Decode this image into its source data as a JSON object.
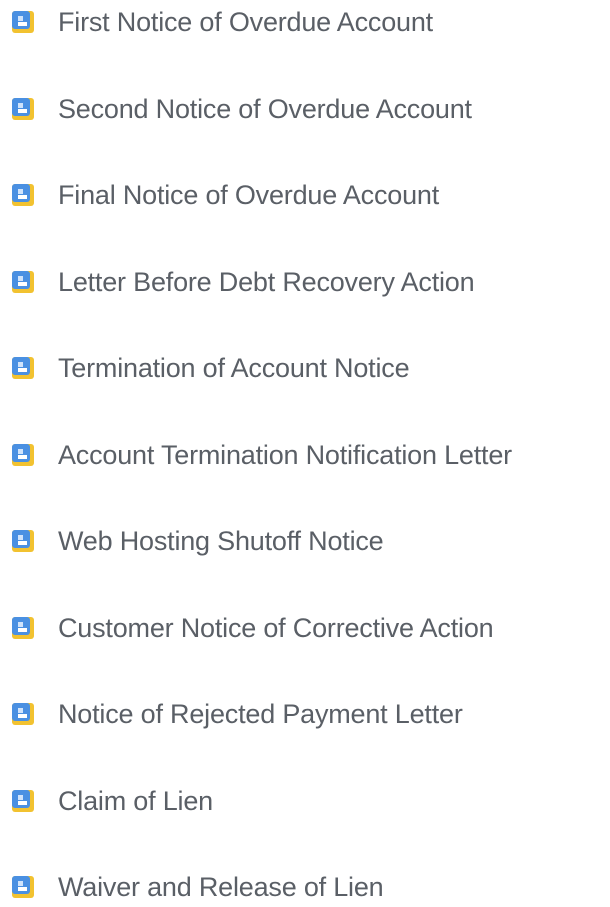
{
  "documents": [
    {
      "label": "First Notice of Overdue Account",
      "icon": "document-icon"
    },
    {
      "label": "Second Notice of Overdue Account",
      "icon": "document-icon"
    },
    {
      "label": "Final Notice of Overdue Account",
      "icon": "document-icon"
    },
    {
      "label": "Letter Before Debt Recovery Action",
      "icon": "document-icon"
    },
    {
      "label": "Termination of Account Notice",
      "icon": "document-icon"
    },
    {
      "label": "Account Termination Notification Letter",
      "icon": "document-icon"
    },
    {
      "label": "Web Hosting Shutoff Notice",
      "icon": "document-icon"
    },
    {
      "label": "Customer Notice of Corrective Action",
      "icon": "document-icon"
    },
    {
      "label": "Notice of Rejected Payment Letter",
      "icon": "document-icon"
    },
    {
      "label": "Claim of Lien",
      "icon": "document-icon"
    },
    {
      "label": "Waiver and Release of Lien",
      "icon": "document-icon"
    }
  ],
  "colors": {
    "icon_blue": "#4a90e2",
    "icon_yellow": "#f2c230",
    "icon_light": "#cfe3fb",
    "text": "#5a5f66"
  }
}
